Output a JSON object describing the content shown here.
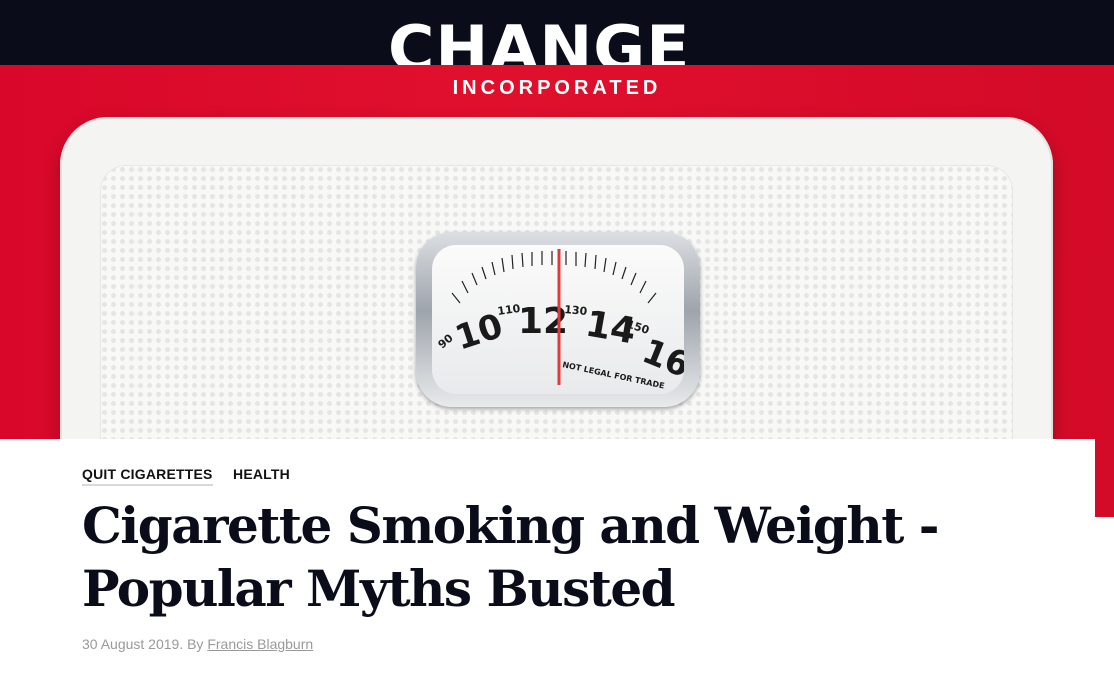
{
  "header": {
    "logo_main": "CHANGE",
    "logo_sub": "INCORPORATED"
  },
  "hero": {
    "image": "bathroom-scale-photo",
    "dial": {
      "large_numbers": [
        "10",
        "12",
        "14",
        "16"
      ],
      "small_numbers": [
        "90",
        "110",
        "130",
        "150"
      ],
      "text": "NOT LEGAL FOR TRADE"
    }
  },
  "article": {
    "tags": [
      "QUIT CIGARETTES",
      "HEALTH"
    ],
    "title_line1": "Cigarette Smoking and Weight -",
    "title_line2": "Popular Myths Busted",
    "date_prefix": "30 August 2019. By ",
    "author": "Francis Blagburn"
  },
  "colors": {
    "topbar": "#0b0c1a",
    "hero_red": "#e0102d",
    "title": "#0b0c1a",
    "meta": "#9a9a9a"
  }
}
